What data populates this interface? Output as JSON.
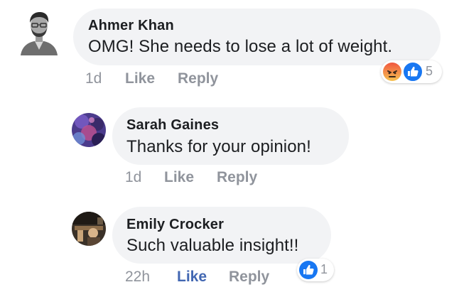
{
  "comments": [
    {
      "author": "Ahmer Khan",
      "text": "OMG! She needs to lose a lot of weight.",
      "time": "1d",
      "like_label": "Like",
      "reply_label": "Reply",
      "reactions": {
        "icons": [
          "angry-icon",
          "like-icon"
        ],
        "count": "5"
      }
    },
    {
      "author": "Sarah Gaines",
      "text": "Thanks for your opinion!",
      "time": "1d",
      "like_label": "Like",
      "reply_label": "Reply"
    },
    {
      "author": "Emily Crocker",
      "text": "Such valuable insight!!",
      "time": "22h",
      "like_label": "Like",
      "reply_label": "Reply",
      "liked": true,
      "reactions": {
        "icons": [
          "like-icon"
        ],
        "count": "1"
      }
    }
  ],
  "colors": {
    "bubble": "#f2f3f5",
    "text": "#1c1e21",
    "meta": "#90949c",
    "like_active": "#4267b2",
    "like_reaction": "#1877f2",
    "angry_reaction_top": "#f0563f",
    "angry_reaction_bottom": "#f7c251"
  }
}
